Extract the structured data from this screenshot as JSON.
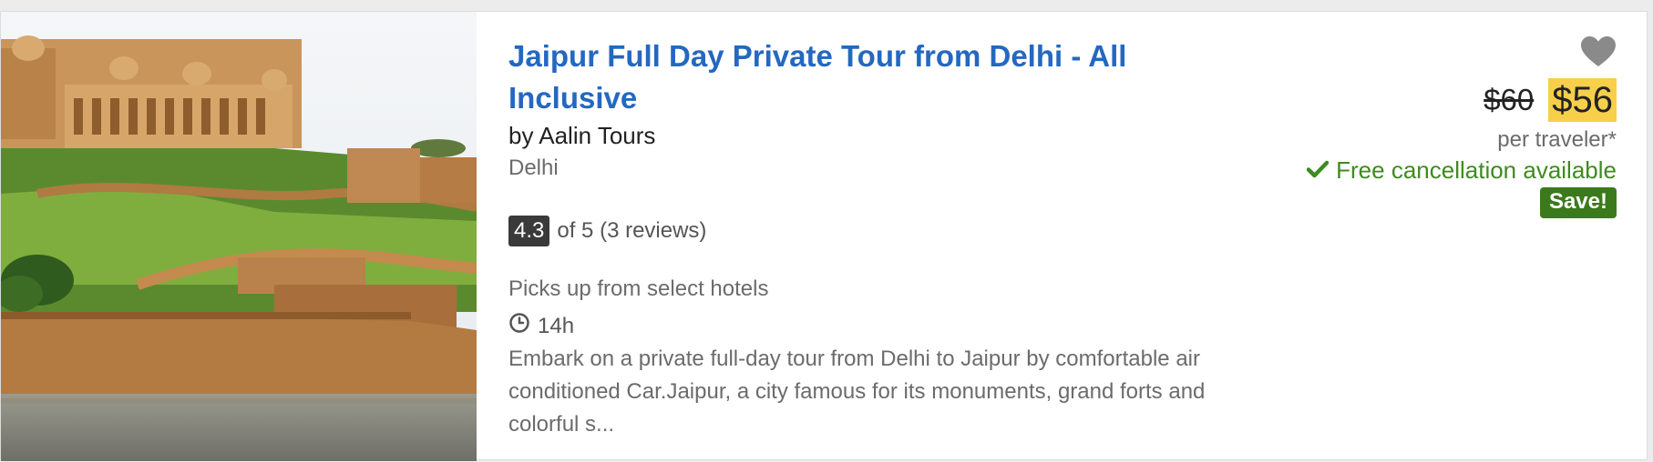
{
  "listing": {
    "title": "Jaipur Full Day Private Tour from Delhi - All Inclusive",
    "operator": "by Aalin Tours",
    "location": "Delhi",
    "rating_value": "4.3",
    "rating_text": "of 5 (3 reviews)",
    "pickup": "Picks up from select hotels",
    "duration": "14h",
    "description": "Embark on a private full-day tour from Delhi to Jaipur by comfortable air conditioned Car.Jaipur, a city famous for its monuments, grand forts and colorful s...",
    "old_price": "$60",
    "new_price": "$56",
    "price_unit": "per traveler*",
    "cancellation": "Free cancellation available",
    "save_label": "Save!"
  },
  "icons": {
    "favorite": "heart-icon",
    "duration": "clock-icon",
    "cancellation": "checkmark-icon"
  },
  "colors": {
    "title": "#2468c0",
    "price_highlight": "#f8cf4a",
    "cancellation": "#3f8b1f",
    "save_badge": "#3b7a1c",
    "rating_badge": "#3a3a3a"
  }
}
